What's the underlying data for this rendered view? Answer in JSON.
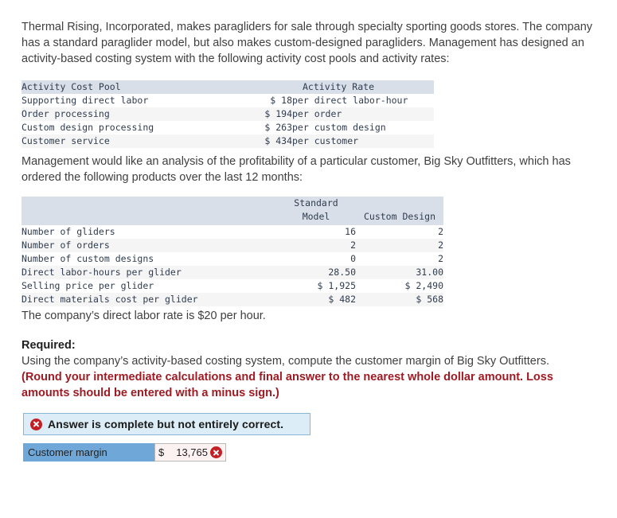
{
  "intro_paragraph": "Thermal Rising, Incorporated, makes paragliders for sale through specialty sporting goods stores. The company has a standard paraglider model, but also makes custom-designed paragliders. Management has designed an activity-based costing system with the following activity cost pools and activity rates:",
  "analysis_paragraph": "Management would like an analysis of the profitability of a particular customer, Big Sky Outfitters, which has ordered the following products over the last 12 months:",
  "labor_rate_paragraph": "The company’s direct labor rate is $20 per hour.",
  "activity_rate_table": {
    "headers": {
      "cost_pool": "Activity Cost Pool",
      "activity_rate": "Activity Rate"
    },
    "rows": [
      {
        "pool": "Supporting direct labor",
        "rate": "$ 18",
        "unit": "per direct labor-hour"
      },
      {
        "pool": "Order processing",
        "rate": "$ 194",
        "unit": "per order"
      },
      {
        "pool": "Custom design processing",
        "rate": "$ 263",
        "unit": "per custom design"
      },
      {
        "pool": "Customer service",
        "rate": "$ 434",
        "unit": "per customer"
      }
    ]
  },
  "customer_orders_table": {
    "headers": {
      "blank": "",
      "standard_model": "Standard\nModel",
      "custom_design": "Custom Design"
    },
    "rows": [
      {
        "item": "Number of gliders",
        "standard": "16",
        "custom": "2"
      },
      {
        "item": "Number of orders",
        "standard": "2",
        "custom": "2"
      },
      {
        "item": "Number of custom designs",
        "standard": "0",
        "custom": "2"
      },
      {
        "item": "Direct labor-hours per glider",
        "standard": "28.50",
        "custom": "31.00"
      },
      {
        "item": "Selling price per glider",
        "standard": "$ 1,925",
        "custom": "$ 2,490"
      },
      {
        "item": "Direct materials cost per glider",
        "standard": "$ 482",
        "custom": "$ 568"
      }
    ]
  },
  "required": {
    "heading": "Required:",
    "text": "Using the company’s activity-based costing system, compute the customer margin of Big Sky Outfitters.",
    "note": "(Round your intermediate calculations and final answer to the nearest whole dollar amount. Loss amounts should be entered with a minus sign.)"
  },
  "answer": {
    "banner_text": "Answer is complete but not entirely correct.",
    "banner_icon": "error-x-icon",
    "label": "Customer margin",
    "currency": "$",
    "value": "13,765",
    "status_icon": "error-x-icon"
  },
  "colors": {
    "table_header_bg": "#d8dfe9",
    "banner_bg": "#dcedf7",
    "banner_border": "#8ab6d6",
    "answer_label_bg": "#6fa8d8",
    "answer_value_bg": "#fdf2f2",
    "error_red": "#c32026",
    "note_red": "#9e1b23"
  }
}
